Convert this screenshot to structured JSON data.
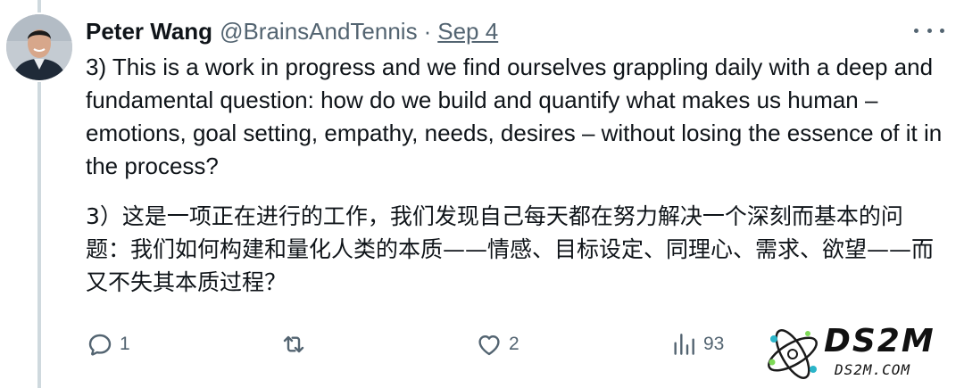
{
  "author": {
    "display_name": "Peter Wang",
    "handle": "@BrainsAndTennis",
    "separator": "·",
    "date": "Sep 4"
  },
  "tweet": {
    "text_en": "3) This is a work in progress and we find ourselves grappling daily with a deep and fundamental question: how do we build and quantify what makes us human – emotions, goal setting, empathy, needs, desires – without losing the essence of it in the process?",
    "text_zh": "3）这是一项正在进行的工作，我们发现自己每天都在努力解决一个深刻而基本的问题：我们如何构建和量化人类的本质——情感、目标设定、同理心、需求、欲望——而又不失其本质过程？"
  },
  "actions": {
    "replies": "1",
    "retweets": "",
    "likes": "2",
    "views": "93"
  },
  "watermark": {
    "title": "DS2M",
    "subtitle": "DS2M.COM"
  },
  "colors": {
    "text_primary": "#0f1419",
    "text_secondary": "#536471",
    "thread_line": "#cfd9de"
  }
}
